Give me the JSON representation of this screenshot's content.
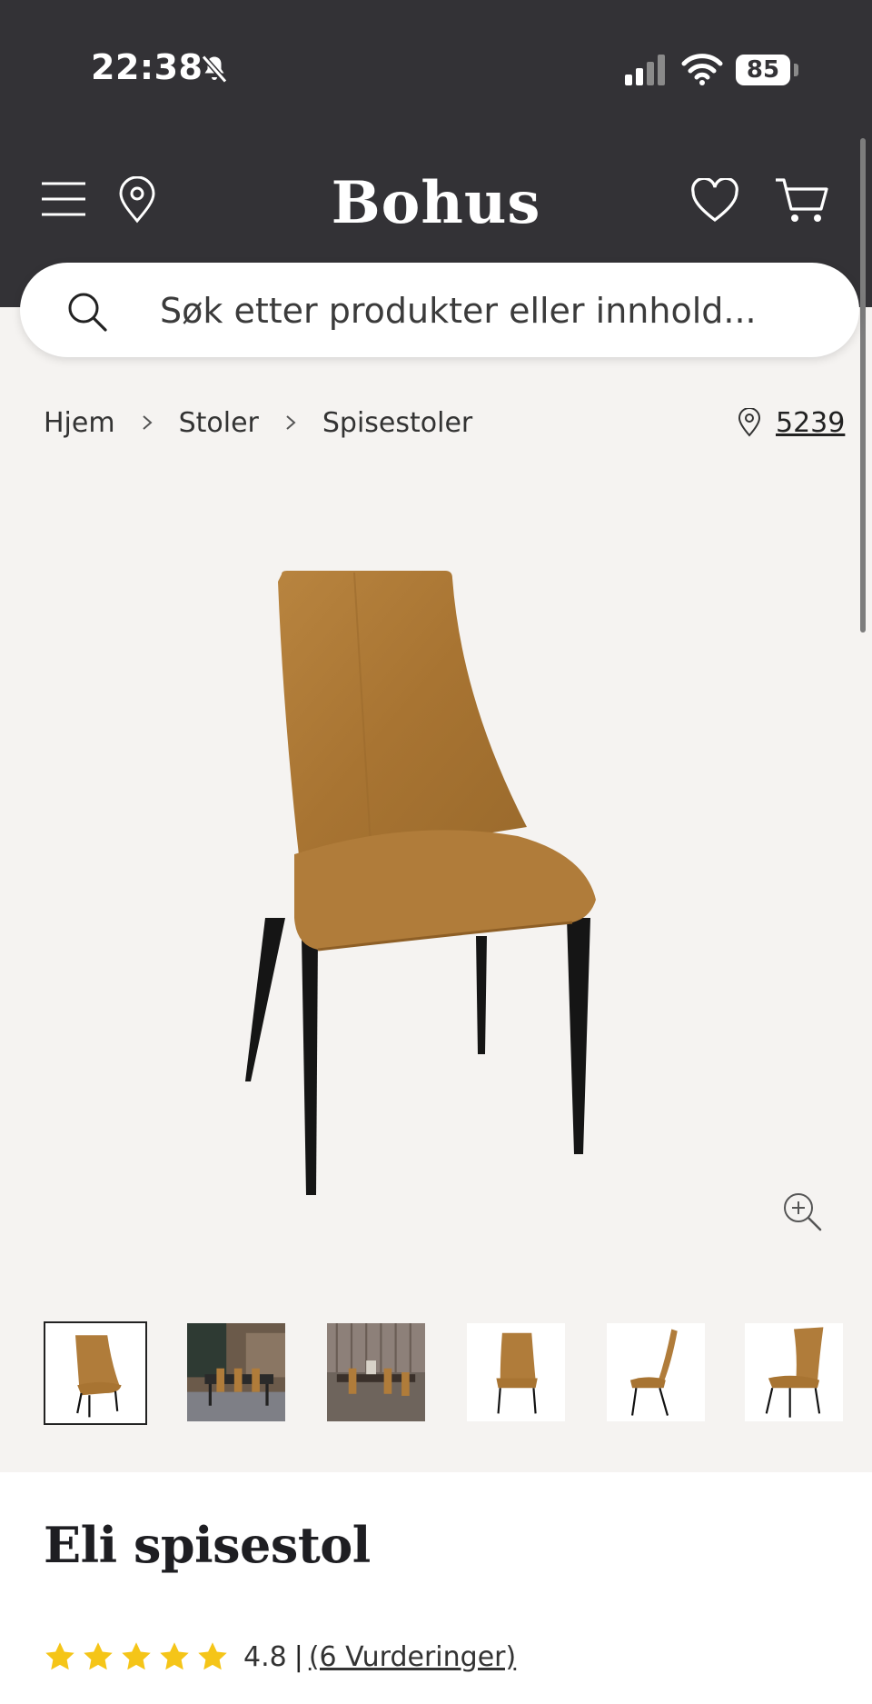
{
  "status_bar": {
    "time": "22:38",
    "battery": "85"
  },
  "header": {
    "logo": "Bohus"
  },
  "search": {
    "placeholder": "Søk etter produkter eller innhold..."
  },
  "breadcrumb": {
    "items": [
      "Hjem",
      "Stoler",
      "Spisestoler"
    ]
  },
  "location": {
    "postal_code": "5239"
  },
  "gallery": {
    "thumbnails": [
      {
        "type": "chair-front",
        "active": true
      },
      {
        "type": "room-scene"
      },
      {
        "type": "room-scene"
      },
      {
        "type": "chair-front"
      },
      {
        "type": "chair-side"
      },
      {
        "type": "chair-three-quarter"
      }
    ]
  },
  "product": {
    "title": "Eli spisestol",
    "rating": "4.8",
    "rating_separator": "|",
    "reviews": "(6 Vurderinger)",
    "stars": 5
  },
  "colors": {
    "header_bg": "#333236",
    "star": "#f5c518",
    "upholstery": "#b07c3a"
  }
}
